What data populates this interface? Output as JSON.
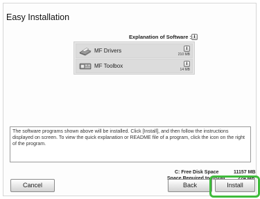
{
  "window": {
    "title": "Easy Installation",
    "explanation_label": "Explanation of Software :",
    "explanation_icon": "i"
  },
  "software": [
    {
      "name": "MF Drivers",
      "size": "210 MB",
      "icon": "printer-icon"
    },
    {
      "name": "MF Toolbox",
      "size": "14 MB",
      "icon": "scanner-icon"
    }
  ],
  "description": "The software programs shown above will be installed. Click [Install], and then follow the instructions displayed on screen. To view the quick explanation or README file of a program, click the icon on the right of the program.",
  "disk": {
    "free_label": "C: Free Disk Space",
    "free_value": "11157 MB",
    "required_label": "Space Required to Install",
    "required_value": "224 MB"
  },
  "buttons": {
    "cancel": "Cancel",
    "back": "Back",
    "install": "Install"
  },
  "colors": {
    "highlight": "#3fbb3b",
    "list_bg": "#e6e6e6"
  }
}
